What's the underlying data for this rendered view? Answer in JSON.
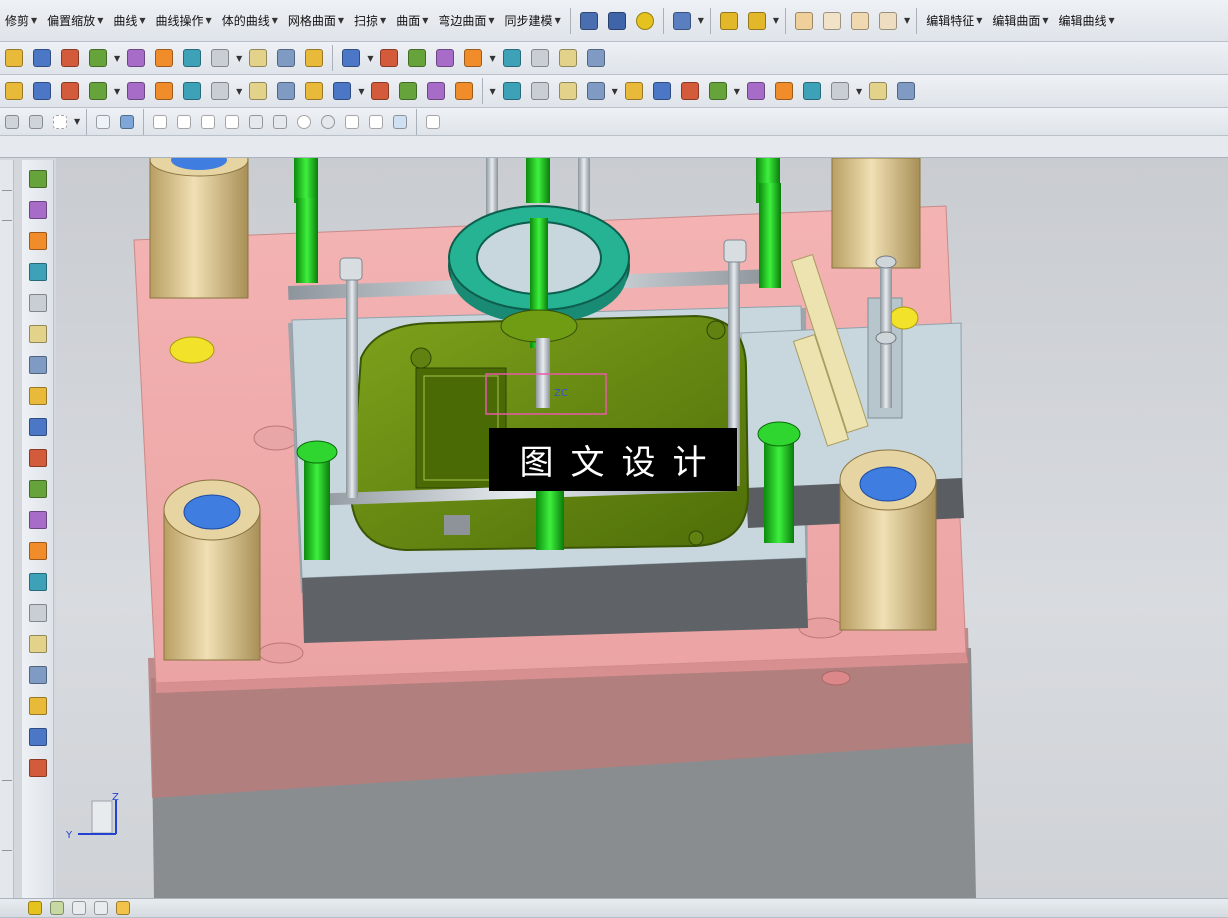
{
  "menu": {
    "items": [
      {
        "label": "修剪"
      },
      {
        "label": "偏置缩放"
      },
      {
        "label": "曲线"
      },
      {
        "label": "曲线操作"
      },
      {
        "label": "体的曲线"
      },
      {
        "label": "网格曲面"
      },
      {
        "label": "扫掠"
      },
      {
        "label": "曲面"
      },
      {
        "label": "弯边曲面"
      },
      {
        "label": "同步建模"
      }
    ],
    "edit_items": [
      {
        "label": "编辑特征"
      },
      {
        "label": "编辑曲面"
      },
      {
        "label": "编辑曲线"
      }
    ]
  },
  "watermark": {
    "text": "图文设计"
  },
  "triad": {
    "z": "Z",
    "y": "Y"
  },
  "colors": {
    "mold_plate": "#f2a8a8",
    "guide_bushing": "#e0cfa0",
    "bolt": "#22c422",
    "locating_ring": "#1f9e84",
    "part": "#6b8f12",
    "insert": "#c8d7dd"
  },
  "icons": {
    "row2": [
      "extrude-icon",
      "revolve-icon",
      "hole-icon",
      "boss-icon",
      "block-icon",
      "cylinder-icon",
      "cone-icon",
      "sphere-icon",
      "pocket-icon",
      "pad-icon",
      "emboss-icon",
      "offset-face-icon"
    ],
    "row3": [
      "pin-icon",
      "ejector-icon",
      "slide-icon",
      "lifter-icon",
      "cooling-icon",
      "screw-icon",
      "gate-icon",
      "runner-icon",
      "sprue-icon",
      "bom-icon",
      "drawing-icon"
    ],
    "palette": [
      "view-cube-icon",
      "assembly-icon",
      "move-icon",
      "feature-icon",
      "solid-icon",
      "surface-icon",
      "sweep-icon",
      "layer-icon",
      "material-icon",
      "measure-icon",
      "section-icon",
      "render-icon",
      "mold-wizard-icon",
      "parting-icon",
      "core-cavity-icon",
      "standard-part-icon",
      "electrode-icon",
      "chart-icon",
      "coordinate-icon",
      "export-icon"
    ]
  }
}
